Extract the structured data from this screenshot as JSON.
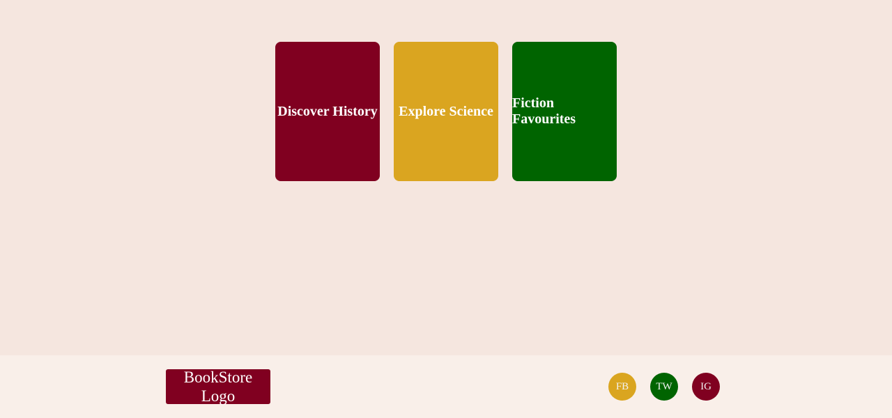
{
  "cards": [
    {
      "title": "Discover History",
      "color": "#800020"
    },
    {
      "title": "Explore Science",
      "color": "#daa520"
    },
    {
      "title": "Fiction Favourites",
      "color": "#006400"
    }
  ],
  "footer": {
    "logo_text": "BookStore Logo",
    "logo_color": "#800020",
    "social": [
      {
        "label": "FB",
        "color": "#daa520"
      },
      {
        "label": "TW",
        "color": "#006400"
      },
      {
        "label": "IG",
        "color": "#800020"
      }
    ]
  },
  "colors": {
    "page_background": "#f5e6df",
    "footer_background": "#f9efe9"
  }
}
